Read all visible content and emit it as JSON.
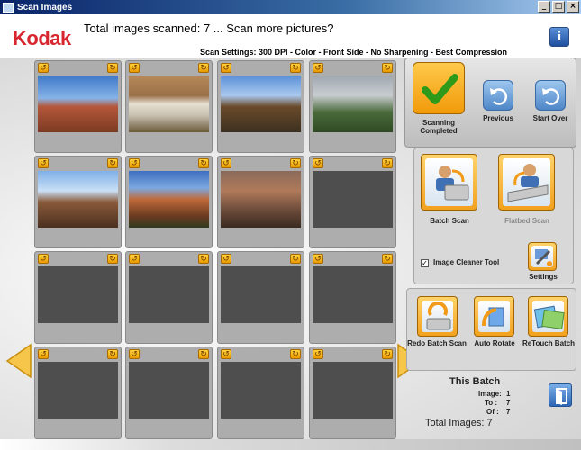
{
  "window": {
    "title": "Scan Images",
    "minimize_glyph": "_",
    "maximize_glyph": "□",
    "close_glyph": "×"
  },
  "header": {
    "logo": "Kodak",
    "headline": "Total images scanned: 7 ... Scan more pictures?",
    "settings": "Scan Settings: 300 DPI - Color - Front Side - No Sharpening - Best Compression",
    "info_glyph": "i"
  },
  "grid": {
    "thumbnails": [
      {
        "filled": true,
        "scene": "canyon-red"
      },
      {
        "filled": true,
        "scene": "sign-grand-canyon"
      },
      {
        "filled": true,
        "scene": "building-tree"
      },
      {
        "filled": true,
        "scene": "building-garden"
      },
      {
        "filled": true,
        "scene": "canyon-vista"
      },
      {
        "filled": true,
        "scene": "canyon-cliffs"
      },
      {
        "filled": true,
        "scene": "canyon-deep"
      },
      {
        "filled": false
      },
      {
        "filled": false
      },
      {
        "filled": false
      },
      {
        "filled": false
      },
      {
        "filled": false
      },
      {
        "filled": false
      },
      {
        "filled": false
      },
      {
        "filled": false
      },
      {
        "filled": false
      }
    ]
  },
  "panel": {
    "scanning_completed": "Scanning Completed",
    "previous": "Previous",
    "start_over": "Start Over",
    "batch_scan": "Batch Scan",
    "flatbed_scan": "Flatbed Scan",
    "image_cleaner_tool": "Image Cleaner Tool",
    "image_cleaner_checked": true,
    "settings": "Settings",
    "redo_batch_scan": "Redo Batch Scan",
    "auto_rotate": "Auto Rotate",
    "retouch_batch": "ReTouch Batch"
  },
  "batch": {
    "title": "This Batch",
    "image_label": "Image:",
    "image_value": "1",
    "to_label": "To :",
    "to_value": "7",
    "of_label": "Of :",
    "of_value": "7",
    "total_images": "Total Images: 7"
  },
  "colors": {
    "brand": "#d7262f",
    "accent": "#f2a11e",
    "titlebar": "#0a246a"
  }
}
